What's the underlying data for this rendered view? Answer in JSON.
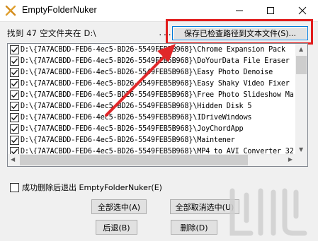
{
  "window": {
    "title": "EmptyFolderNuker"
  },
  "header": {
    "found_label": "找到 47 空文件夹在 D:\\",
    "dots": "...",
    "save_button": "保存已检查路径到文本文件(S)..."
  },
  "list": {
    "items": [
      {
        "path": "D:\\{7A7ACBDD-FED6-4ec5-BD26-5549FEB5B968}\\Chrome Expansion Pack",
        "checked": true
      },
      {
        "path": "D:\\{7A7ACBDD-FED6-4ec5-BD26-5549FEB5B968}\\DoYourData File Eraser",
        "checked": true
      },
      {
        "path": "D:\\{7A7ACBDD-FED6-4ec5-BD26-5549FEB5B968}\\Easy Photo Denoise",
        "checked": true
      },
      {
        "path": "D:\\{7A7ACBDD-FED6-4ec5-BD26-5549FEB5B968}\\Easy Shaky Video Fixer",
        "checked": true
      },
      {
        "path": "D:\\{7A7ACBDD-FED6-4ec5-BD26-5549FEB5B968}\\Free Photo Slideshow Ma",
        "checked": true
      },
      {
        "path": "D:\\{7A7ACBDD-FED6-4ec5-BD26-5549FEB5B968}\\Hidden Disk 5",
        "checked": true
      },
      {
        "path": "D:\\{7A7ACBDD-FED6-4ec5-BD26-5549FEB5B968}\\IDriveWindows",
        "checked": true
      },
      {
        "path": "D:\\{7A7ACBDD-FED6-4ec5-BD26-5549FEB5B968}\\JoyChordApp",
        "checked": true
      },
      {
        "path": "D:\\{7A7ACBDD-FED6-4ec5-BD26-5549FEB5B968}\\Maintener",
        "checked": true
      },
      {
        "path": "D:\\{7A7ACBDD-FED6-4ec5-BD26-5549FEB5B968}\\MP4_to_AVI_Converter_32",
        "checked": true
      }
    ]
  },
  "options": {
    "exit_after_delete_label": "成功删除后退出 EmptyFolderNuker(E)",
    "exit_after_delete_checked": false
  },
  "buttons": {
    "select_all": "全部选中(A)",
    "deselect_all": "全部取消选中(U)",
    "back": "后退(B)",
    "delete": "删除(D)"
  },
  "colors": {
    "highlight_box": "#e11d1d",
    "arrow": "#e0282a",
    "focus_border": "#0078d7"
  },
  "icons": {
    "app": "crossed-tools-icon",
    "minimize": "minimize-icon",
    "maximize": "maximize-icon",
    "close": "close-icon"
  }
}
